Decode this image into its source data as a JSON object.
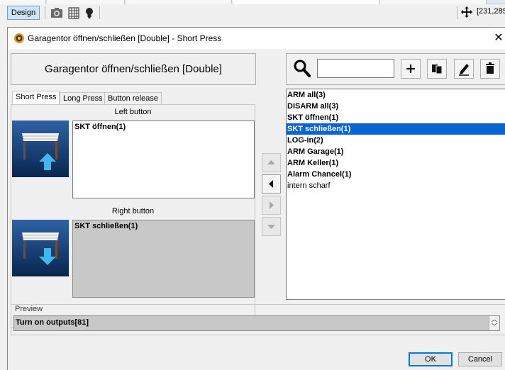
{
  "toolbar": {
    "design_label": "Design",
    "coords": "[231,285"
  },
  "dialog": {
    "title": "Garagentor öffnen/schließen [Double] - Short Press",
    "close_glyph": "✕",
    "device_name": "Garagentor öffnen/schließen [Double]",
    "tabs": [
      "Short Press",
      "Long Press",
      "Button release"
    ],
    "left_button_label": "Left button",
    "right_button_label": "Right button",
    "left_assignment": "SKT öffnen(1)",
    "right_assignment": "SKT schließen(1)",
    "search_placeholder": "",
    "modes": [
      {
        "label": "ARM all(3)",
        "bold": true
      },
      {
        "label": "DISARM all(3)",
        "bold": true
      },
      {
        "label": "SKT öffnen(1)",
        "bold": true
      },
      {
        "label": "SKT schließen(1)",
        "bold": true,
        "selected": true
      },
      {
        "label": "LOG-in(2)",
        "bold": true
      },
      {
        "label": "ARM Garage(1)",
        "bold": true
      },
      {
        "label": "ARM Keller(1)",
        "bold": true
      },
      {
        "label": "Alarm Chancel(1)",
        "bold": true
      },
      {
        "label": "intern scharf",
        "bold": false
      }
    ],
    "preview_label": "Preview",
    "preview_value": "Turn on outputs[81]",
    "ok_label": "OK",
    "cancel_label": "Cancel"
  },
  "colors": {
    "selection": "#0a64d4",
    "tile_blue": "#1a4b8a",
    "arrow_up": "#29a9e8"
  }
}
